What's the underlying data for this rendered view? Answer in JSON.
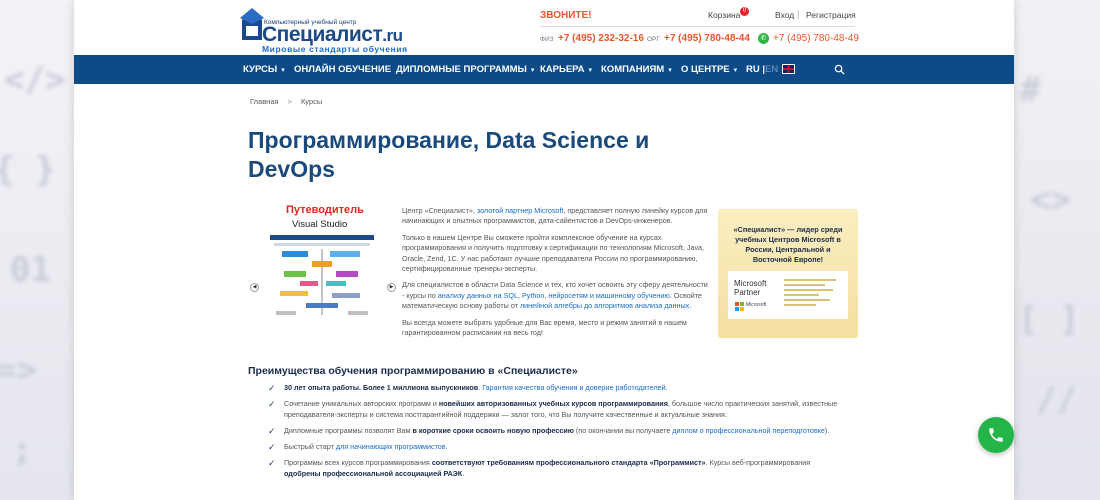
{
  "header": {
    "logo_small": "Компьютерный учебный центр",
    "logo_main": "Специалист",
    "logo_domain": ".ru",
    "logo_tagline": "Мировые стандарты обучения",
    "call_label": "ЗВОНИТЕ!",
    "cart_label": "Корзина",
    "cart_count": "0",
    "login_label": "Вход",
    "separator": "|",
    "register_label": "Регистрация",
    "phone_private_label": "ФИЗ",
    "phone_private": "+7 (495) 232-32-16",
    "phone_corp_label": "ОРГ",
    "phone_corp": "+7 (495) 780-48-44",
    "phone_whatsapp": "+7 (495) 780-48-49"
  },
  "nav": {
    "items": [
      {
        "label": "КУРСЫ",
        "has_caret": true
      },
      {
        "label": "ОНЛАЙН ОБУЧЕНИЕ",
        "has_caret": false
      },
      {
        "label": "ДИПЛОМНЫЕ ПРОГРАММЫ",
        "has_caret": true
      },
      {
        "label": "КАРЬЕРА",
        "has_caret": true
      },
      {
        "label": "КОМПАНИЯМ",
        "has_caret": true
      },
      {
        "label": "О ЦЕНТРЕ",
        "has_caret": true
      }
    ],
    "lang_ru": "RU",
    "lang_sep": "|",
    "lang_en": "EN",
    "caret": "▾"
  },
  "breadcrumb": {
    "home": "Главная",
    "separator": ">",
    "current": "Курсы"
  },
  "page_title": "Программирование, Data Science и DevOps",
  "guide": {
    "title": "Путеводитель",
    "subtitle": "Visual Studio",
    "prev": "◀",
    "next": "▶"
  },
  "intro": {
    "p1_a": "Центр «Специалист», ",
    "p1_link": "золотой партнер Microsoft",
    "p1_b": ", представляет полную линейку курсов для начинающих и опытных программистов, дата-сайентистов и DevOps-инженеров.",
    "p2": "Только в нашем Центре Вы сможете пройти комплексное обучение на курсах программирования и получить подготовку к сертификации по технологиям Microsoft, Java, Oracle, Zend, 1С. У нас работают лучшие преподаватели России по программированию, сертифицированные тренеры-эксперты.",
    "p3_a": "Для специалистов в области Data Science и тех, кто хочет освоить эту сферу деятельности - курсы по ",
    "p3_link1": "анализу данных на SQL",
    "p3_b": ", ",
    "p3_link2": "Python",
    "p3_c": ", ",
    "p3_link3": "нейросетям и машинному обучению",
    "p3_d": ". Освойте математическую основу работы от ",
    "p3_link4": "линейной алгебры до алгоритмов анализа данных",
    "p3_e": ".",
    "p4": "Вы всегда можете выбрать удобные для Вас время, место и режим занятий в нашем гарантированном расписании на весь год!"
  },
  "partner": {
    "text": "«Специалист» — лидер среди учебных Центров Microsoft в России, Центральной и Восточной Европе!",
    "ms_line1": "Microsoft",
    "ms_line2": "Partner",
    "ms_word": "Microsoft"
  },
  "advantages": {
    "title": "Преимущества обучения программированию в «Специалисте»",
    "check": "✓",
    "items": [
      {
        "bold": "30 лет опыта работы. Более 1 миллиона выпускников",
        "text": ". ",
        "link": "Гарантия качества обучения и доверие работодателей",
        "tail": "."
      },
      {
        "text": "Сочетание уникальных авторских программ и ",
        "bold": "новейших авторизованных учебных курсов программирования",
        "tail": ", большое число практических занятий, известные преподаватели-эксперты и система постгарантийной поддержки — залог того, что Вы получите качественные и актуальные знания."
      },
      {
        "text": "Дипломные программы позволят Вам ",
        "bold": "в короткие сроки освоить новую профессию",
        "tail": " (по окончании вы получаете ",
        "link": "диплом о профессиональной переподготовке",
        "end": ")."
      },
      {
        "text": "Быстрый старт ",
        "link": "для начинающих программистов",
        "tail": "."
      },
      {
        "text": "Программы всех курсов программирования ",
        "bold": "соответствуют требованиям профессионального стандарта «Программист»",
        "tail": ". Курсы веб-программирования ",
        "bold2": "одобрены профессиональной ассоциацией РАЭК",
        "end": "."
      }
    ]
  },
  "colors": {
    "brand_blue": "#0d4a86",
    "accent_orange": "#e8562a",
    "title_blue": "#1a4a7c",
    "link_blue": "#1a6cc4",
    "call_green": "#23b547"
  }
}
